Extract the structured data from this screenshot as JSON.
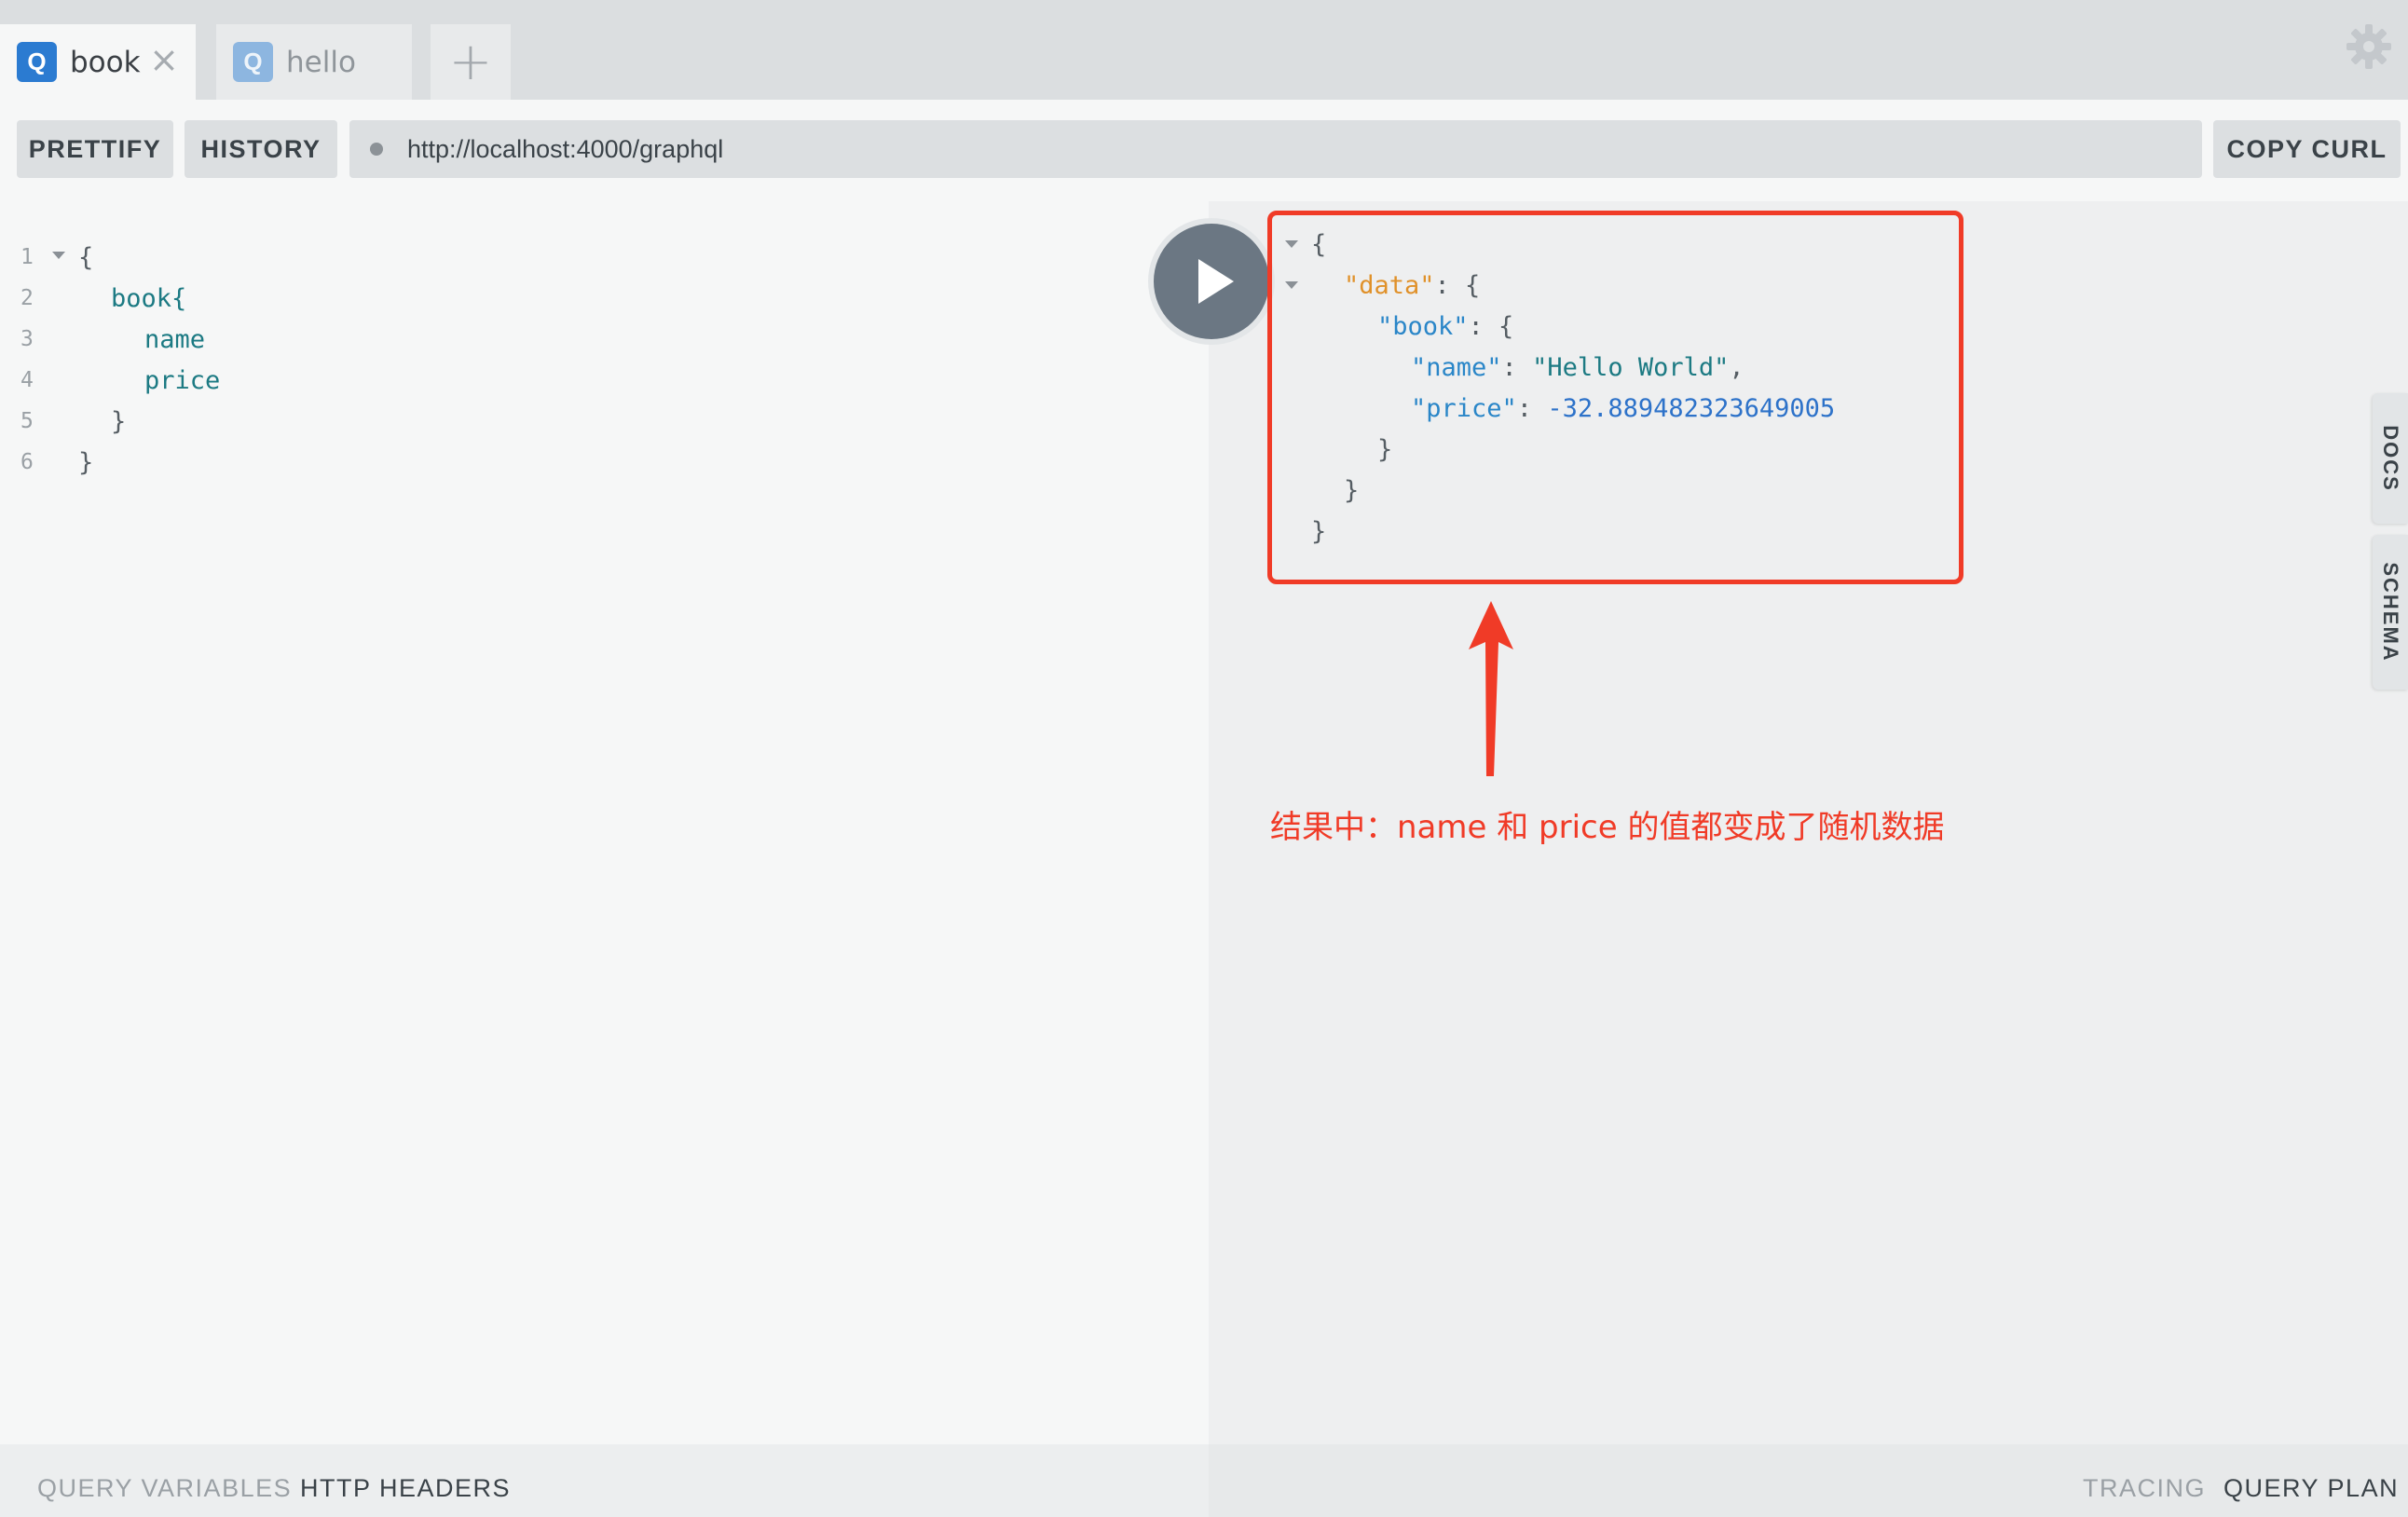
{
  "tabs": [
    {
      "badge": "Q",
      "name": "book",
      "active": true,
      "close": "×"
    },
    {
      "badge": "Q",
      "name": "hello",
      "active": false
    }
  ],
  "add_tab_label": "+",
  "toolbar": {
    "prettify_label": "PRETTIFY",
    "history_label": "HISTORY",
    "endpoint_url": "http://localhost:4000/graphql",
    "copy_curl_label": "COPY CURL"
  },
  "editor": {
    "line_numbers": [
      "1",
      "2",
      "3",
      "4",
      "5",
      "6"
    ],
    "lines": [
      "{",
      "book{",
      "name",
      "price",
      "}",
      "}"
    ]
  },
  "result": {
    "open_brace": "{",
    "data_key": "\"data\"",
    "book_key": "\"book\"",
    "name_key": "\"name\"",
    "name_value": "\"Hello World\"",
    "price_key": "\"price\"",
    "price_value": "-32.889482323649005",
    "close_brace": "}"
  },
  "annotation": "结果中：name 和 price 的值都变成了随机数据",
  "side_tabs": {
    "docs": "DOCS",
    "schema": "SCHEMA"
  },
  "bottom": {
    "query_variables": "QUERY VARIABLES",
    "http_headers": "HTTP HEADERS",
    "tracing": "TRACING",
    "query_plan": "QUERY PLAN"
  },
  "colors": {
    "annotation_red": "#f03b27",
    "query_badge_blue": "#2b7bd1",
    "field_teal": "#1c7a83",
    "key_blue": "#2a86c8",
    "data_key_orange": "#e0912a"
  },
  "icons": [
    "gear-icon",
    "play-icon",
    "close-icon",
    "plus-icon",
    "fold-arrow-icon",
    "arrow-up-icon"
  ]
}
